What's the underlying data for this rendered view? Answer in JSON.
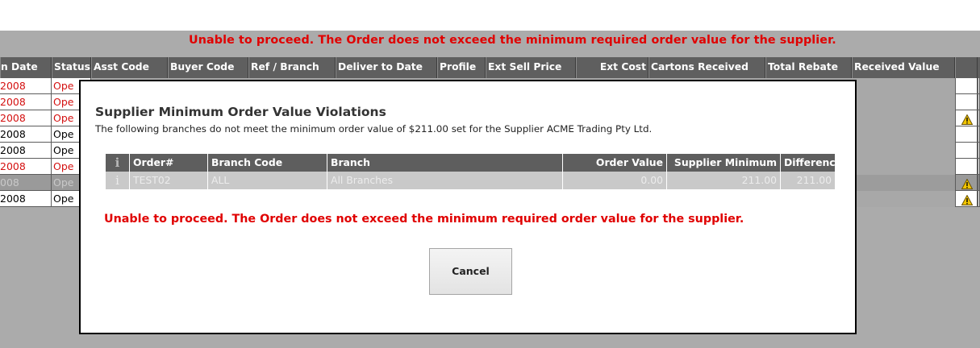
{
  "top_error": "Unable to proceed. The Order does not exceed the minimum required order value for the supplier.",
  "grid": {
    "headers": [
      "n Date",
      "Status",
      "Asst Code",
      "Buyer Code",
      "Ref / Branch",
      "Deliver to Date",
      "Profile",
      "Ext Sell Price",
      "Ext Cost",
      "Cartons Received",
      "Total Rebate",
      "Received Value"
    ],
    "rows": [
      {
        "date": "2008",
        "status": "Ope",
        "red": true,
        "warning": false,
        "muted": false
      },
      {
        "date": "2008",
        "status": "Ope",
        "red": true,
        "warning": false,
        "muted": false
      },
      {
        "date": "2008",
        "status": "Ope",
        "red": true,
        "warning": true,
        "muted": false
      },
      {
        "date": "2008",
        "status": "Ope",
        "red": false,
        "warning": false,
        "muted": false
      },
      {
        "date": "2008",
        "status": "Ope",
        "red": false,
        "warning": false,
        "muted": false
      },
      {
        "date": "2008",
        "status": "Ope",
        "red": true,
        "warning": false,
        "muted": false
      },
      {
        "date": "008",
        "status": "Ope",
        "red": false,
        "warning": true,
        "muted": true
      },
      {
        "date": "2008",
        "status": "Ope",
        "red": false,
        "warning": true,
        "muted": false
      }
    ]
  },
  "modal": {
    "title": "Supplier Minimum Order Value Violations",
    "description": "The following branches do not meet the minimum order value of $211.00 set for the Supplier ACME Trading Pty Ltd.",
    "table": {
      "headers": [
        "Order#",
        "Branch Code",
        "Branch",
        "Order Value",
        "Supplier Minimum",
        "Difference"
      ],
      "row": {
        "order": "TEST02",
        "branch_code": "ALL",
        "branch": "All Branches",
        "order_value": "0.00",
        "supplier_minimum": "211.00",
        "difference": "211.00"
      }
    },
    "error": "Unable to proceed. The Order does not exceed the minimum required order value for the supplier.",
    "cancel_label": "Cancel"
  },
  "icons": {
    "info": "info-icon",
    "warning": "warning-icon"
  },
  "colors": {
    "error_red": "#e00000",
    "header_bg": "#5f5f5f",
    "warning_yellow": "#f2c500"
  }
}
